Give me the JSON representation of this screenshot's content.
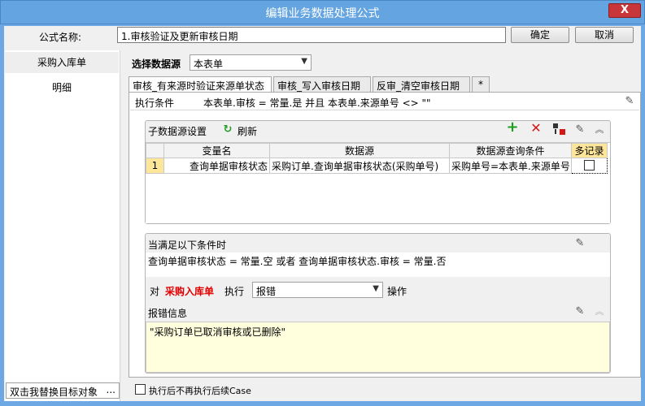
{
  "window": {
    "title": "编辑业务数据处理公式",
    "close_label": "X"
  },
  "formula": {
    "name_label": "公式名称:",
    "name_value": "1.审核验证及更新审核日期",
    "ok_label": "确定",
    "cancel_label": "取消"
  },
  "sidebar": {
    "items": [
      {
        "label": "采购入库单",
        "selected": true
      },
      {
        "label": "明细",
        "selected": false
      }
    ],
    "replace_target": "双击我替换目标对象",
    "replace_more": "..."
  },
  "datasource": {
    "label": "选择数据源",
    "value": "本表单"
  },
  "tabs": [
    {
      "label": "审核_有来源时验证来源单状态",
      "active": true
    },
    {
      "label": "审核_写入审核日期",
      "active": false
    },
    {
      "label": "反审_清空审核日期",
      "active": false
    },
    {
      "label": "*",
      "active": false
    }
  ],
  "condition": {
    "label": "执行条件",
    "value": "本表单.审核 = 常量.是 并且 本表单.来源单号 <> \"\""
  },
  "subsource": {
    "title": "子数据源设置",
    "refresh_label": "刷新",
    "columns": [
      "变量名",
      "数据源",
      "数据源查询条件",
      "多记录"
    ],
    "rows": [
      {
        "index": "1",
        "variable": "查询单据审核状态",
        "source": "采购订单.查询单据审核状态(采购单号)",
        "query": "采购单号=本表单.来源单号",
        "multi": false
      }
    ]
  },
  "when": {
    "title": "当满足以下条件时",
    "expr": "查询单据审核状态 = 常量.空 或者 查询单据审核状态.审核 = 常量.否",
    "for_label": "对",
    "target": "采购入库单",
    "exec_label": "执行",
    "action": "报错",
    "op_label": "操作",
    "error_label": "报错信息",
    "error_text": "\"采购订单已取消审核或已删除\""
  },
  "footer": {
    "stop_label": "执行后不再执行后续Case",
    "stop_checked": false
  },
  "colors": {
    "title_bar": "#64a4e0",
    "close_button": "#c8363a",
    "add_icon": "#1e9e1e",
    "delete_icon": "#d01818",
    "target_text": "#e00000",
    "refresh_icon": "#2a9a2a",
    "multi_header": "#fde69a"
  }
}
